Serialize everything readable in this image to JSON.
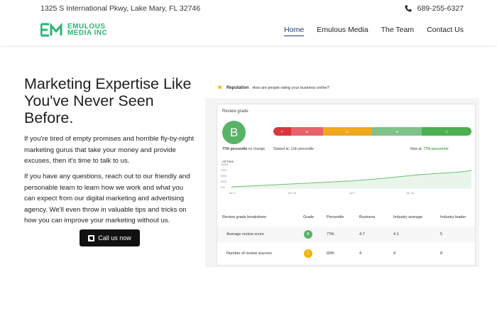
{
  "topbar": {
    "address": "1325 S International Pkwy, Lake Mary, FL 32746",
    "phone": "689-255-6327"
  },
  "logo": {
    "line1": "EMULOUS",
    "line2": "MEDIA INC"
  },
  "nav": [
    "Home",
    "Emulous Media",
    "The Team",
    "Contact Us"
  ],
  "hero": {
    "title": "Marketing Expertise Like You've Never Seen Before.",
    "p1": "If you're tired of empty promises and horrible fly-by-night marketing gurus that take your money and provide excuses, then it's time to talk to us.",
    "p2": "If you have any questions, reach out to our friendly and personable team to learn how we work and what you can expect from our digital marketing and advertising agency. We'll even throw in valuable tips and tricks on how you can improve your marketing without us.",
    "cta": "Call us now"
  },
  "dashboard": {
    "title": "Reputation",
    "question": "How are people rating your business online?",
    "review_grade_label": "Review grade",
    "grade": "B",
    "percentile_text": "77th percentile",
    "no_change": "no change",
    "started_at": "Started at: 11th percentile",
    "now_at_label": "Now at:",
    "now_at_value": "77th percentile",
    "grade_bands": [
      {
        "label": "F",
        "color": "#d9363e"
      },
      {
        "label": "D",
        "color": "#e8636a"
      },
      {
        "label": "C",
        "color": "#f0a81c"
      },
      {
        "label": "B",
        "color": "#7fc28a"
      },
      {
        "label": "A",
        "color": "#4caf50"
      }
    ],
    "chart": {
      "range_label": "All Time",
      "y_ticks": [
        "100%",
        "75%",
        "50%",
        "25%",
        "0%"
      ],
      "x_ticks": [
        "Jun 1",
        "Jun 15",
        "Jul 1",
        "Jul 15"
      ]
    },
    "table": {
      "headers": [
        "Review grade breakdown",
        "Grade",
        "Percentile",
        "Business",
        "Industry average",
        "Industry leader"
      ],
      "rows": [
        {
          "name": "Average review score",
          "grade": "B",
          "grade_color": "#58b368",
          "percentile": "77th",
          "business": "4.7",
          "industry_avg": "4.1",
          "leader": "5"
        },
        {
          "name": "Number of review sources",
          "grade": "C",
          "grade_color": "#f0b400",
          "percentile": "60th",
          "business": "4",
          "industry_avg": "4",
          "leader": "8"
        }
      ]
    }
  }
}
